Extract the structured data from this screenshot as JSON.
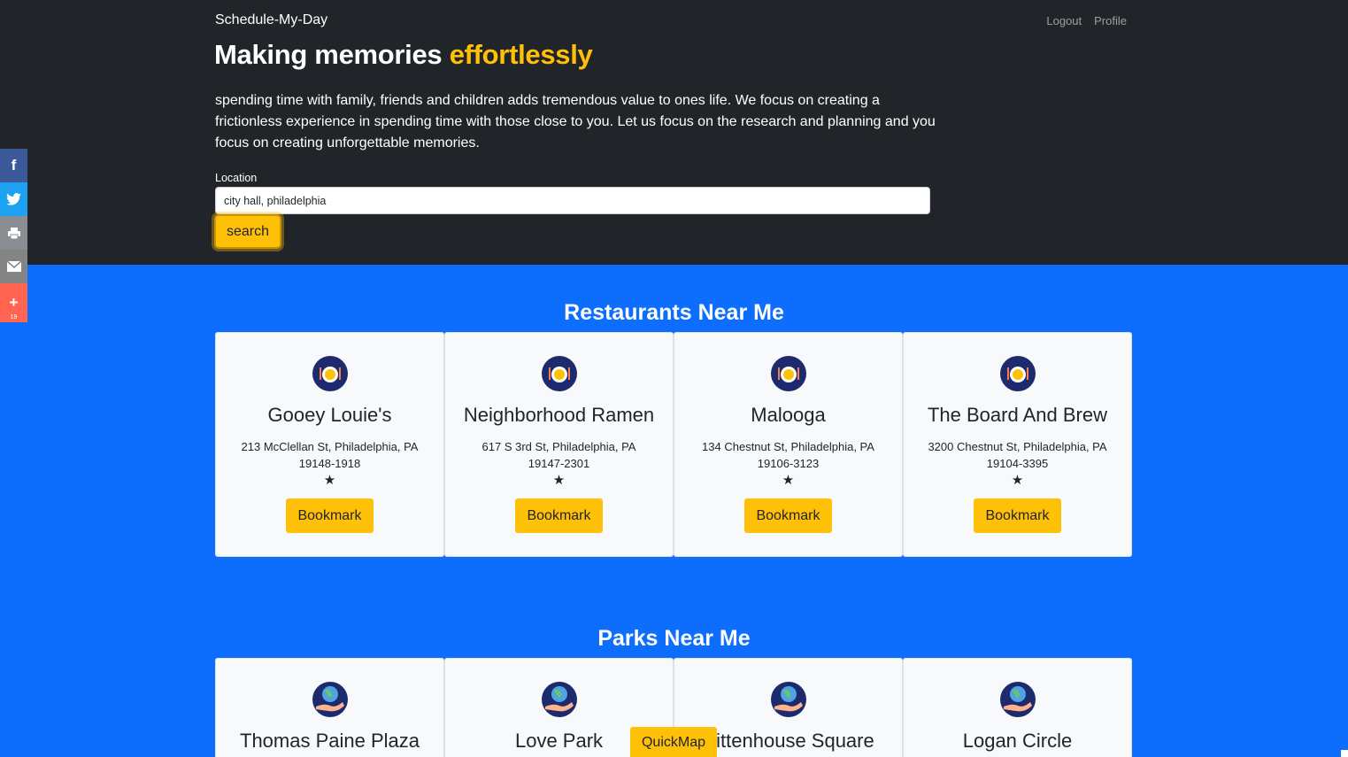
{
  "header": {
    "brand": "Schedule-My-Day",
    "nav": [
      "Logout",
      "Profile"
    ],
    "headline_main": "Making memories ",
    "headline_accent": "effortlessly",
    "lead": "spending time with family, friends and children adds tremendous value to ones life. We focus on creating a frictionless experience in spending time with those close to you. Let us focus on the research and planning and you focus on creating unforgettable memories.",
    "location_label": "Location",
    "location_value": "city hall, philadelphia",
    "search_label": "search"
  },
  "share_bar": {
    "icons": [
      "facebook-icon",
      "twitter-icon",
      "print-icon",
      "email-icon",
      "add-icon"
    ],
    "count": "19"
  },
  "restaurants": {
    "title": "Restaurants Near Me",
    "items": [
      {
        "name": "Gooey Louie's",
        "address": "213 McClellan St, Philadelphia, PA 19148-1918",
        "rating": "★",
        "button": "Bookmark"
      },
      {
        "name": "Neighborhood Ramen",
        "address": "617 S 3rd St, Philadelphia, PA 19147-2301",
        "rating": "★",
        "button": "Bookmark"
      },
      {
        "name": "Malooga",
        "address": "134 Chestnut St, Philadelphia, PA 19106-3123",
        "rating": "★",
        "button": "Bookmark"
      },
      {
        "name": "The Board And Brew",
        "address": "3200 Chestnut St, Philadelphia, PA 19104-3395",
        "rating": "★",
        "button": "Bookmark"
      }
    ]
  },
  "parks": {
    "title": "Parks Near Me",
    "items": [
      {
        "name": "Thomas Paine Plaza"
      },
      {
        "name": "Love Park"
      },
      {
        "name": "Rittenhouse Square"
      },
      {
        "name": "Logan Circle"
      }
    ]
  },
  "quickmap_label": "QuickMap",
  "colors": {
    "dark": "#212529",
    "accent": "#ffc107",
    "primary": "#0d6efd"
  }
}
